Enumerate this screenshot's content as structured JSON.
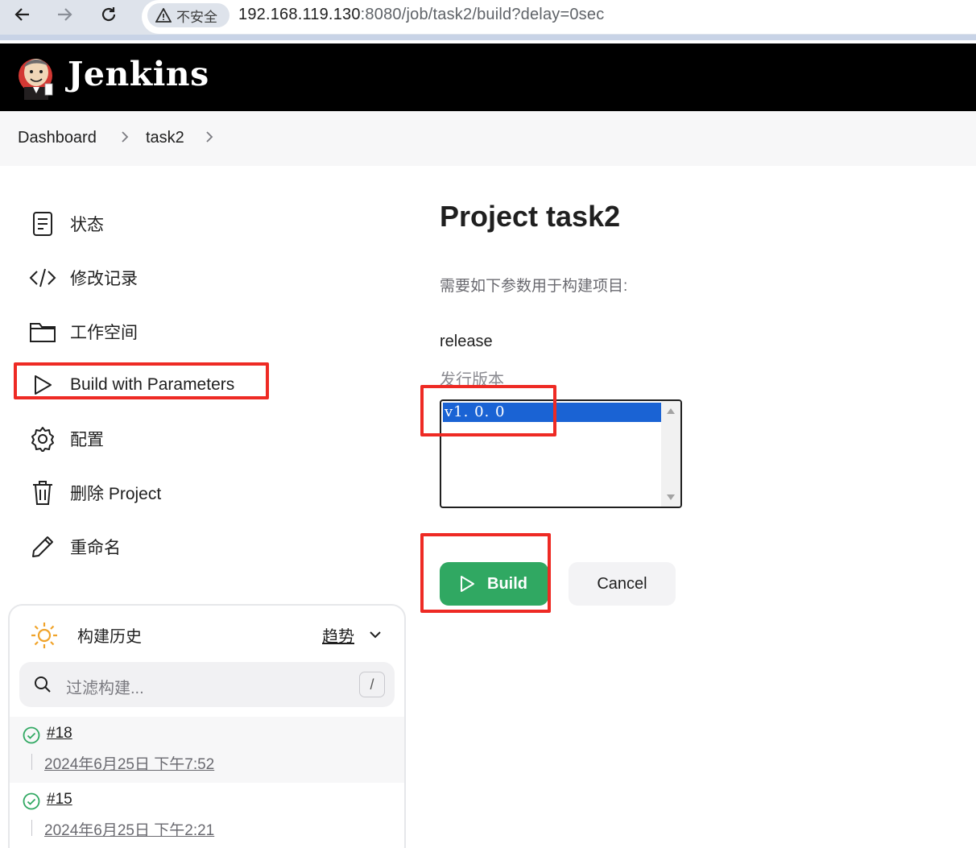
{
  "browser": {
    "security_label": "不安全",
    "url_host": "192.168.119.130",
    "url_rest": ":8080/job/task2/build?delay=0sec"
  },
  "header": {
    "title": "Jenkins"
  },
  "breadcrumb": {
    "items": [
      "Dashboard",
      "task2"
    ]
  },
  "sidebar": {
    "items": [
      {
        "label": "状态",
        "icon": "document-icon"
      },
      {
        "label": "修改记录",
        "icon": "code-icon"
      },
      {
        "label": "工作空间",
        "icon": "folder-icon"
      },
      {
        "label": "Build with Parameters",
        "icon": "play-icon"
      },
      {
        "label": "配置",
        "icon": "gear-icon"
      },
      {
        "label": "删除 Project",
        "icon": "trash-icon"
      },
      {
        "label": "重命名",
        "icon": "pencil-icon"
      }
    ]
  },
  "history": {
    "title": "构建历史",
    "trend": "趋势",
    "filter_placeholder": "过滤构建...",
    "shortcut": "/",
    "builds": [
      {
        "number": "#18",
        "date": "2024年6月25日 下午7:52",
        "status": "success"
      },
      {
        "number": "#15",
        "date": "2024年6月25日 下午2:21",
        "status": "success"
      }
    ]
  },
  "main": {
    "title": "Project task2",
    "description": "需要如下参数用于构建项目:",
    "param_name": "release",
    "param_description": "发行版本",
    "options": [
      "v1.0.0"
    ],
    "selected_option": "v1. 0. 0",
    "build_label": "Build",
    "cancel_label": "Cancel"
  },
  "colors": {
    "build_green": "#30a862",
    "highlight_red": "#ee2a24",
    "selected_blue": "#1a63d4"
  }
}
